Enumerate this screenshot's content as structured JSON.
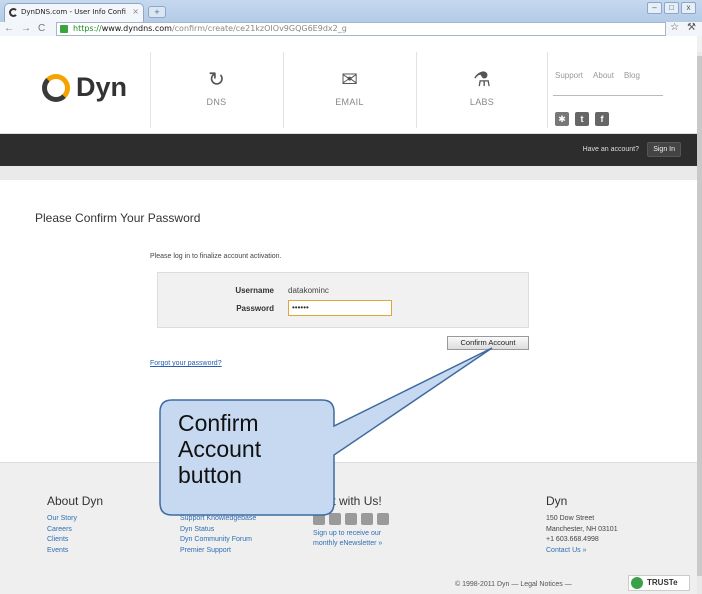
{
  "browser": {
    "tab_title": "DynDNS.com - User Info Confi",
    "tab_close": "×",
    "new_tab": "+",
    "url_scheme": "https://",
    "url_host": "www.dyndns.com",
    "url_path": "/confirm/create/ce21kzOIOv9GQG6E9dx2_g",
    "window_buttons": [
      "–",
      "□",
      "x"
    ],
    "nav_icons": [
      "back-arrow-icon",
      "forward-arrow-icon",
      "reload-icon"
    ],
    "toolbar_icons": [
      "star-icon",
      "wrench-icon"
    ]
  },
  "header": {
    "logo_text": "Dyn",
    "nav": [
      {
        "label": "DNS",
        "icon": "dns-icon"
      },
      {
        "label": "EMAIL",
        "icon": "envelope-icon"
      },
      {
        "label": "LABS",
        "icon": "flask-icon"
      }
    ],
    "util_links": [
      "Support",
      "About",
      "Blog"
    ],
    "social_icons": [
      "flag-uk-icon",
      "twitter-icon",
      "facebook-icon"
    ],
    "have_account": "Have an account?",
    "sign_in": "Sign In"
  },
  "main": {
    "title": "Please Confirm Your Password",
    "instructions": "Please log in to finalize account activation.",
    "username_label": "Username",
    "username_value": "datakominc",
    "password_label": "Password",
    "password_value": "••••••",
    "confirm_button": "Confirm Account",
    "forgot_link": "Forgot your password?"
  },
  "footer": {
    "about": {
      "heading": "About Dyn",
      "links": [
        "Our Story",
        "Careers",
        "Clients",
        "Events"
      ]
    },
    "support": {
      "links": [
        "Support Knowledgebase",
        "Dyn Status",
        "Dyn Community Forum",
        "Premier Support"
      ]
    },
    "connect": {
      "heading_visible": "nect with Us!",
      "newsletter": [
        "Sign up to receive our",
        "monthly eNewsletter »"
      ]
    },
    "contact": {
      "heading": "Dyn",
      "lines": [
        "150 Dow Street",
        "Manchester, NH 03101",
        "+1 603.668.4998"
      ],
      "link": "Contact Us »"
    },
    "copyright": "© 1998-2011 Dyn — Legal Notices —",
    "truste": "TRUSTe"
  },
  "callout": {
    "lines": [
      "Confirm",
      "Account",
      "button"
    ],
    "fill": "#c6d9f1",
    "stroke": "#3f6aa0"
  }
}
